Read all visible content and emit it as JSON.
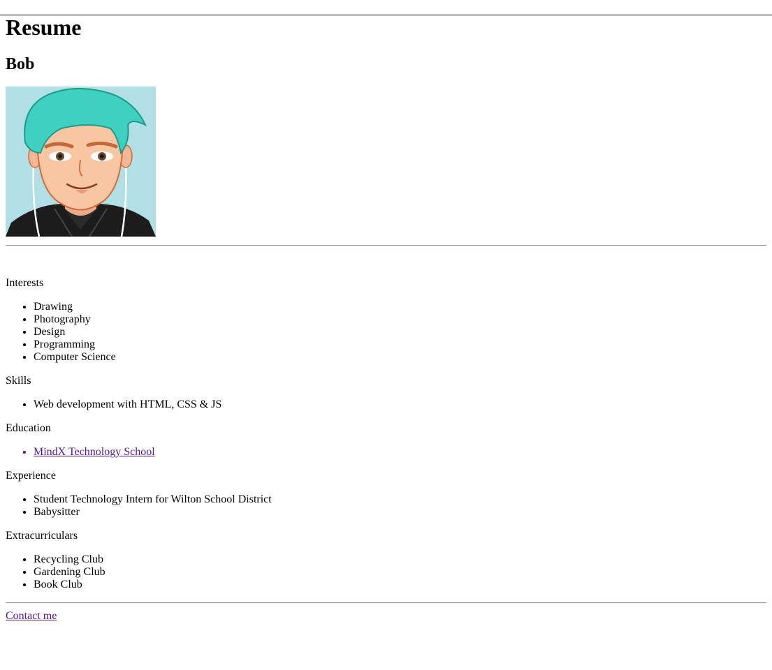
{
  "page": {
    "title": "Resume",
    "name": "Bob"
  },
  "sections": [
    {
      "title": "Interests",
      "items": [
        "Drawing",
        "Photography",
        "Design",
        "Programming",
        "Computer Science"
      ]
    },
    {
      "title": "Skills",
      "items": [
        "Web development with HTML, CSS & JS"
      ]
    },
    {
      "title": "Education",
      "link": "MindX Technology School"
    },
    {
      "title": "Experience",
      "items": [
        "Student Technology Intern for Wilton School District",
        "Babysitter"
      ]
    },
    {
      "title": "Extracurriculars",
      "items": [
        "Recycling Club",
        "Gardening Club",
        "Book Club"
      ]
    }
  ],
  "footer": {
    "contact_label": "Contact me"
  },
  "colors": {
    "visited_link": "#551a8b",
    "avatar_bg": "#b0dfe5",
    "hair": "#3fd1bf",
    "skin": "#f7c6a3"
  },
  "avatar": {
    "icon": "cartoon-avatar-icon"
  }
}
